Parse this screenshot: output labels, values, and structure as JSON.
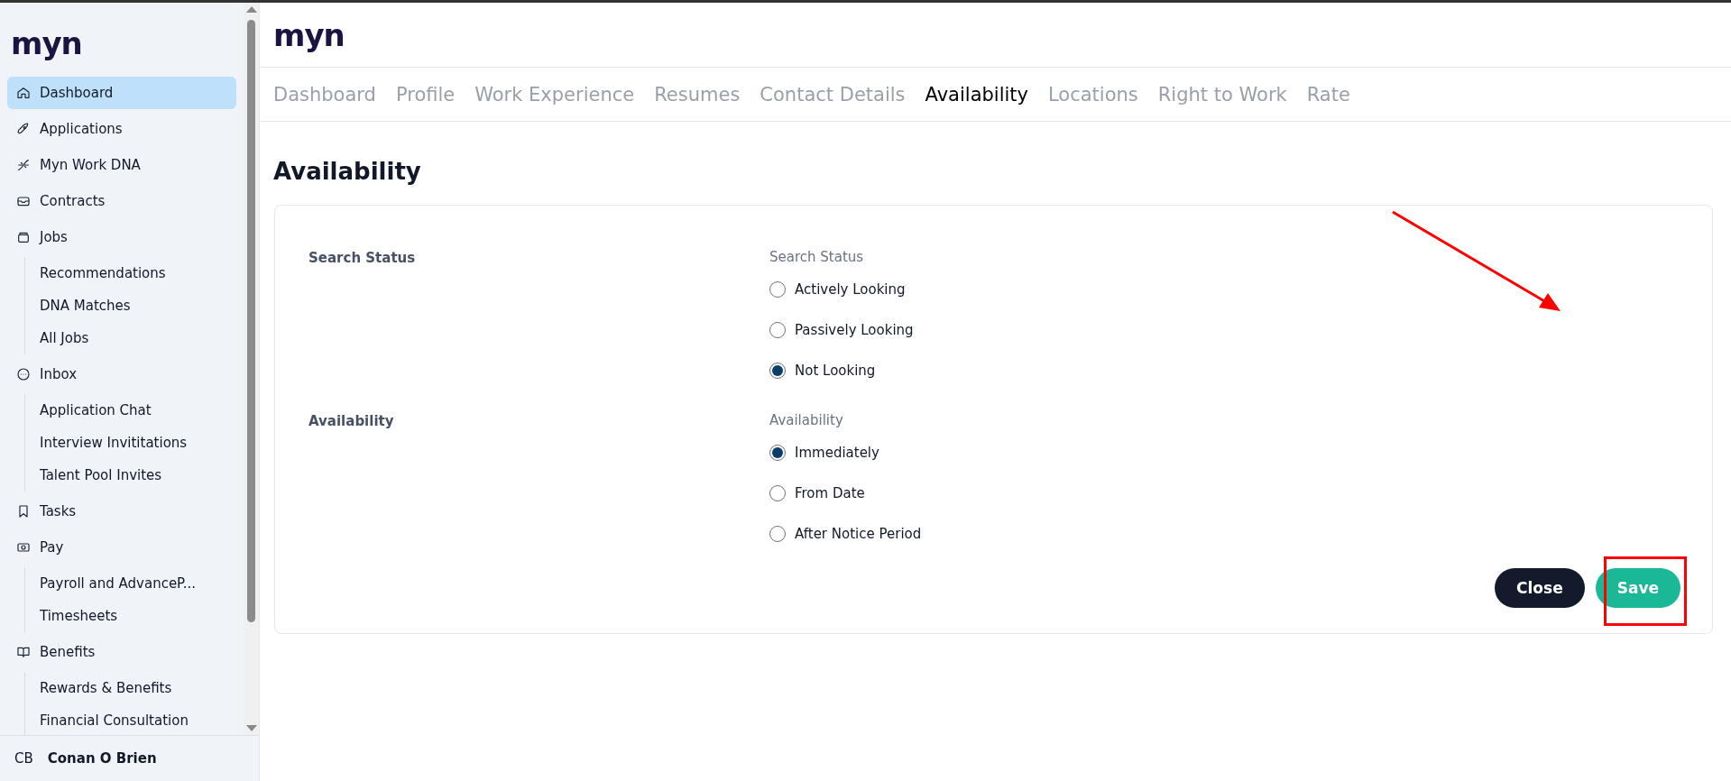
{
  "sidebar": {
    "logo": "myn",
    "items": [
      {
        "label": "Dashboard",
        "selected": true
      },
      {
        "label": "Applications",
        "selected": false
      },
      {
        "label": "Myn Work DNA",
        "selected": false
      },
      {
        "label": "Contracts",
        "selected": false
      },
      {
        "label": "Jobs",
        "selected": false,
        "children": [
          {
            "label": "Recommendations",
            "selected": false
          },
          {
            "label": "DNA Matches",
            "selected": false
          },
          {
            "label": "All Jobs",
            "selected": false
          }
        ]
      },
      {
        "label": "Inbox",
        "selected": false,
        "children": [
          {
            "label": "Application Chat",
            "selected": false
          },
          {
            "label": "Interview Invititations",
            "selected": false
          },
          {
            "label": "Talent Pool Invites",
            "selected": false
          }
        ]
      },
      {
        "label": "Tasks",
        "selected": false
      },
      {
        "label": "Pay",
        "selected": false,
        "children": [
          {
            "label": "Payroll and AdvanceP...",
            "selected": false
          },
          {
            "label": "Timesheets",
            "selected": false
          }
        ]
      },
      {
        "label": "Benefits",
        "selected": false,
        "children": [
          {
            "label": "Rewards & Benefits",
            "selected": false
          },
          {
            "label": "Financial Consultation",
            "selected": false
          }
        ]
      }
    ],
    "user": {
      "initials": "CB",
      "name": "Conan O Brien"
    }
  },
  "header": {
    "logo": "myn"
  },
  "tabs": [
    {
      "label": "Dashboard",
      "selected": false
    },
    {
      "label": "Profile",
      "selected": false
    },
    {
      "label": "Work Experience",
      "selected": false
    },
    {
      "label": "Resumes",
      "selected": false
    },
    {
      "label": "Contact Details",
      "selected": false
    },
    {
      "label": "Availability",
      "selected": true
    },
    {
      "label": "Locations",
      "selected": false
    },
    {
      "label": "Right to Work",
      "selected": false
    },
    {
      "label": "Rate",
      "selected": false
    }
  ],
  "page_title": "Availability",
  "sections": [
    {
      "label": "Search Status",
      "group_label": "Search Status",
      "options": [
        {
          "label": "Actively Looking",
          "selected": false
        },
        {
          "label": "Passively Looking",
          "selected": false
        },
        {
          "label": "Not Looking",
          "selected": true
        }
      ]
    },
    {
      "label": "Availability",
      "group_label": "Availability",
      "options": [
        {
          "label": "Immediately",
          "selected": true
        },
        {
          "label": "From Date",
          "selected": false
        },
        {
          "label": "After Notice Period",
          "selected": false
        }
      ]
    }
  ],
  "buttons": [
    {
      "label": "Close",
      "kind": "secondary"
    },
    {
      "label": "Save",
      "kind": "primary"
    }
  ]
}
